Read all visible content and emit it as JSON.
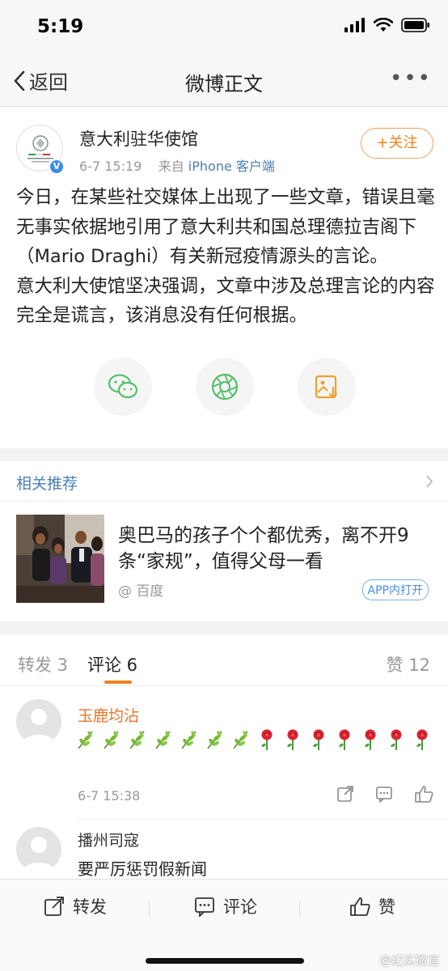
{
  "status_bar": {
    "time": "5:19"
  },
  "nav": {
    "back_label": "返回",
    "title": "微博正文",
    "more": "•••"
  },
  "post": {
    "author": "意大利驻华使馆",
    "date": "6-7 15:19",
    "source_prefix": "来自",
    "source": "iPhone 客户端",
    "follow_label": "+关注",
    "body_1": "今日，在某些社交媒体上出现了一些文章，错误且毫无事实依据地引用了意大利共和国总理德拉吉阁下（Mario Draghi）有关新冠疫情源头的言论。",
    "body_2": "意大利大使馆坚决强调，文章中涉及总理言论的内容完全是谎言，该消息没有任何根据。",
    "share_icons": [
      "wechat-icon",
      "moments-icon",
      "save-image-icon"
    ]
  },
  "related": {
    "title": "相关推荐",
    "headline": "奥巴马的孩子个个都优秀，离不开9条“家规”，值得父母一看",
    "source": "@ 百度",
    "open_app_label": "APP内打开"
  },
  "tabs": {
    "repost": "转发 3",
    "comment": "评论 6",
    "like": "赞 12"
  },
  "comments": [
    {
      "user": "玉鹿均沾",
      "time": "6-7 15:38",
      "emoji_seq": [
        "leaf",
        "leaf",
        "leaf",
        "leaf",
        "leaf",
        "leaf",
        "leaf",
        "rose",
        "rose",
        "rose",
        "rose",
        "rose",
        "rose",
        "rose"
      ]
    },
    {
      "user": "播州司寇",
      "text": "要严厉惩罚假新闻"
    }
  ],
  "bottom_bar": {
    "repost": "转发",
    "comment": "评论",
    "like": "赞"
  },
  "watermark": "@纪实微言",
  "colors": {
    "accent_orange": "#f08020",
    "link_blue": "#4a7fb5",
    "verified_blue": "#3a8ee6"
  }
}
